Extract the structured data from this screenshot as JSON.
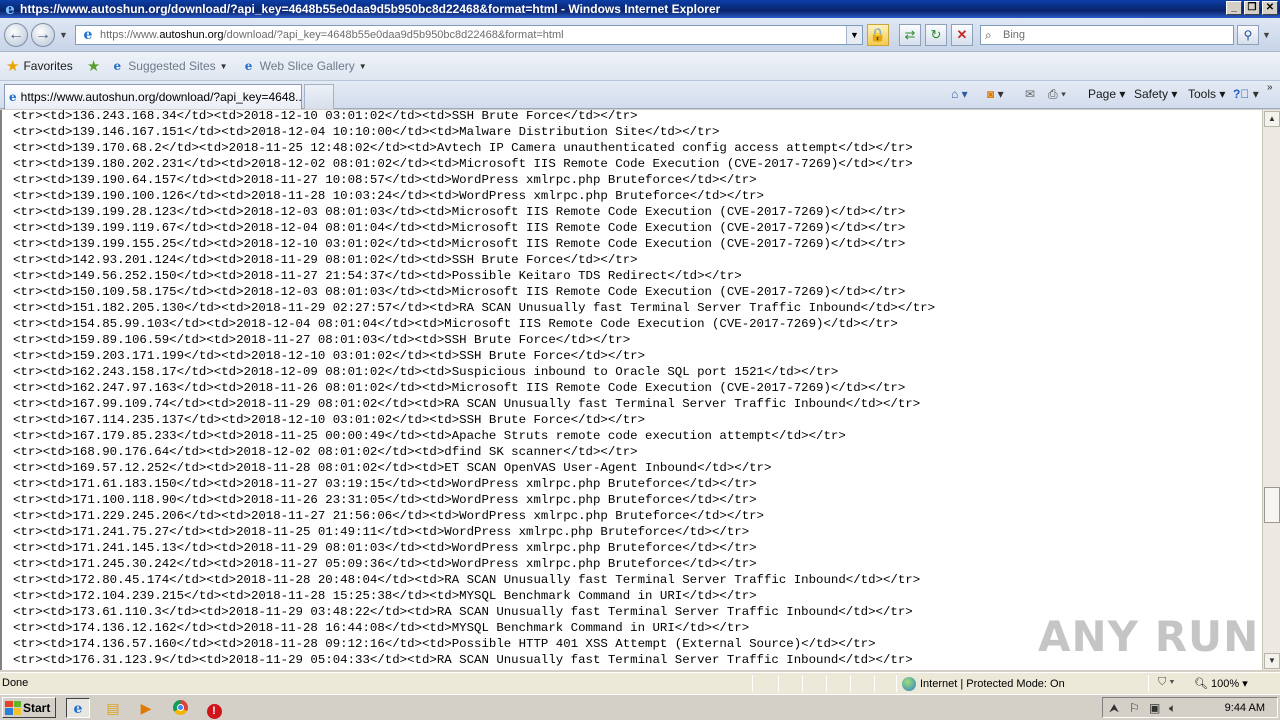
{
  "window": {
    "title": "https://www.autoshun.org/download/?api_key=4648b55e0daa9d5b950bc8d22468&format=html - Windows Internet Explorer",
    "min": "_",
    "restore": "❐",
    "close": "✕"
  },
  "address": {
    "url_prefix": "https://",
    "url_www": "www.",
    "url_host": "autoshun.org",
    "url_rest": "/download/?api_key=4648b55e0daa9d5b950bc8d22468&format=html"
  },
  "search": {
    "placeholder": "Bing"
  },
  "favorites_bar": {
    "favorites": "Favorites",
    "suggested_sites": "Suggested Sites",
    "web_slice": "Web Slice Gallery"
  },
  "tab": {
    "title": "https://www.autoshun.org/download/?api_key=4648..."
  },
  "commands": {
    "page": "Page",
    "safety": "Safety",
    "tools": "Tools"
  },
  "lines": [
    "<tr><td>136.243.168.34</td><td>2018-12-10 03:01:02</td><td>SSH Brute Force</td></tr>",
    "<tr><td>139.146.167.151</td><td>2018-12-04 10:10:00</td><td>Malware Distribution Site</td></tr>",
    "<tr><td>139.170.68.2</td><td>2018-11-25 12:48:02</td><td>Avtech IP Camera unauthenticated config access attempt</td></tr>",
    "<tr><td>139.180.202.231</td><td>2018-12-02 08:01:02</td><td>Microsoft IIS Remote Code Execution (CVE-2017-7269)</td></tr>",
    "<tr><td>139.190.64.157</td><td>2018-11-27 10:08:57</td><td>WordPress xmlrpc.php Bruteforce</td></tr>",
    "<tr><td>139.190.100.126</td><td>2018-11-28 10:03:24</td><td>WordPress xmlrpc.php Bruteforce</td></tr>",
    "<tr><td>139.199.28.123</td><td>2018-12-03 08:01:03</td><td>Microsoft IIS Remote Code Execution (CVE-2017-7269)</td></tr>",
    "<tr><td>139.199.119.67</td><td>2018-12-04 08:01:04</td><td>Microsoft IIS Remote Code Execution (CVE-2017-7269)</td></tr>",
    "<tr><td>139.199.155.25</td><td>2018-12-10 03:01:02</td><td>Microsoft IIS Remote Code Execution (CVE-2017-7269)</td></tr>",
    "<tr><td>142.93.201.124</td><td>2018-11-29 08:01:02</td><td>SSH Brute Force</td></tr>",
    "<tr><td>149.56.252.150</td><td>2018-11-27 21:54:37</td><td>Possible Keitaro TDS Redirect</td></tr>",
    "<tr><td>150.109.58.175</td><td>2018-12-03 08:01:03</td><td>Microsoft IIS Remote Code Execution (CVE-2017-7269)</td></tr>",
    "<tr><td>151.182.205.130</td><td>2018-11-29 02:27:57</td><td>RA SCAN Unusually fast Terminal Server Traffic Inbound</td></tr>",
    "<tr><td>154.85.99.103</td><td>2018-12-04 08:01:04</td><td>Microsoft IIS Remote Code Execution (CVE-2017-7269)</td></tr>",
    "<tr><td>159.89.106.59</td><td>2018-11-27 08:01:03</td><td>SSH Brute Force</td></tr>",
    "<tr><td>159.203.171.199</td><td>2018-12-10 03:01:02</td><td>SSH Brute Force</td></tr>",
    "<tr><td>162.243.158.17</td><td>2018-12-09 08:01:02</td><td>Suspicious inbound to Oracle SQL port 1521</td></tr>",
    "<tr><td>162.247.97.163</td><td>2018-11-26 08:01:02</td><td>Microsoft IIS Remote Code Execution (CVE-2017-7269)</td></tr>",
    "<tr><td>167.99.109.74</td><td>2018-11-29 08:01:02</td><td>RA SCAN Unusually fast Terminal Server Traffic Inbound</td></tr>",
    "<tr><td>167.114.235.137</td><td>2018-12-10 03:01:02</td><td>SSH Brute Force</td></tr>",
    "<tr><td>167.179.85.233</td><td>2018-11-25 00:00:49</td><td>Apache Struts remote code execution attempt</td></tr>",
    "<tr><td>168.90.176.64</td><td>2018-12-02 08:01:02</td><td>dfind SK scanner</td></tr>",
    "<tr><td>169.57.12.252</td><td>2018-11-28 08:01:02</td><td>ET SCAN OpenVAS User-Agent Inbound</td></tr>",
    "<tr><td>171.61.183.150</td><td>2018-11-27 03:19:15</td><td>WordPress xmlrpc.php Bruteforce</td></tr>",
    "<tr><td>171.100.118.90</td><td>2018-11-26 23:31:05</td><td>WordPress xmlrpc.php Bruteforce</td></tr>",
    "<tr><td>171.229.245.206</td><td>2018-11-27 21:56:06</td><td>WordPress xmlrpc.php Bruteforce</td></tr>",
    "<tr><td>171.241.75.27</td><td>2018-11-25 01:49:11</td><td>WordPress xmlrpc.php Bruteforce</td></tr>",
    "<tr><td>171.241.145.13</td><td>2018-11-29 08:01:03</td><td>WordPress xmlrpc.php Bruteforce</td></tr>",
    "<tr><td>171.245.30.242</td><td>2018-11-27 05:09:36</td><td>WordPress xmlrpc.php Bruteforce</td></tr>",
    "<tr><td>172.80.45.174</td><td>2018-11-28 20:48:04</td><td>RA SCAN Unusually fast Terminal Server Traffic Inbound</td></tr>",
    "<tr><td>172.104.239.215</td><td>2018-11-28 15:25:38</td><td>MYSQL Benchmark Command in URI</td></tr>",
    "<tr><td>173.61.110.3</td><td>2018-11-29 03:48:22</td><td>RA SCAN Unusually fast Terminal Server Traffic Inbound</td></tr>",
    "<tr><td>174.136.12.162</td><td>2018-11-28 16:44:08</td><td>MYSQL Benchmark Command in URI</td></tr>",
    "<tr><td>174.136.57.160</td><td>2018-11-28 09:12:16</td><td>Possible HTTP 401 XSS Attempt (External Source)</td></tr>",
    "<tr><td>176.31.123.9</td><td>2018-11-29 05:04:33</td><td>RA SCAN Unusually fast Terminal Server Traffic Inbound</td></tr>"
  ],
  "status": {
    "text": "Done",
    "zone": "Internet | Protected Mode: On",
    "zoom": "100%"
  },
  "taskbar": {
    "start": "Start",
    "clock": "9:44 AM"
  },
  "watermark": "ANY RUN",
  "icons": {
    "ie": "ie-icon",
    "back": "back-arrow-icon",
    "forward": "forward-arrow-icon",
    "lock": "lock-icon",
    "refresh": "refresh-icon",
    "stop": "stop-icon",
    "search": "magnifier-icon",
    "star": "star-icon",
    "home": "home-icon",
    "feeds": "rss-icon",
    "print": "printer-icon",
    "help": "help-icon"
  }
}
